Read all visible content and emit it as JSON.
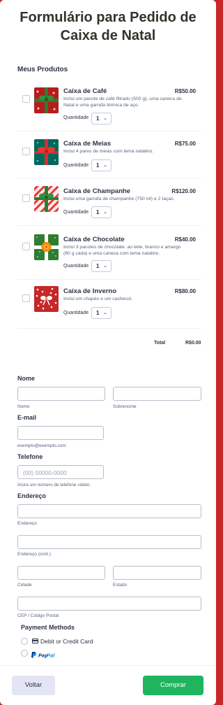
{
  "form": {
    "title_line1": "Formulário para Pedido de",
    "title_line2": "Caixa de Natal"
  },
  "products": {
    "section_label": "Meus Produtos",
    "quantity_label": "Quantidade",
    "items": [
      {
        "name": "Caixa de Café",
        "price": "R$50.00",
        "desc_line1": "Inclui um pacote de café filtrado (500 g), uma caneca de",
        "desc_line2": "Natal e uma garrafa térmica de aço.",
        "quantity": "1",
        "icon": "gift-box-red-green-bow-icon"
      },
      {
        "name": "Caixa de Meias",
        "price": "R$75.00",
        "desc_line1": "Inclui 4 pares de meias com tema natalino.",
        "desc_line2": "",
        "quantity": "1",
        "icon": "gift-box-green-red-bow-icon"
      },
      {
        "name": "Caixa de Champanhe",
        "price": "R$120.00",
        "desc_line1": "Inclui uma garrafa de champanhe (750 ml) e 2 taças.",
        "desc_line2": "",
        "quantity": "1",
        "icon": "gift-box-striped-icon"
      },
      {
        "name": "Caixa de Chocolate",
        "price": "R$40.00",
        "desc_line1": "Inclui 3 pacotes de chocolate: ao leite, branco e amargo",
        "desc_line2": "(60 g cada) e uma caneca com tema natalino.",
        "quantity": "1",
        "icon": "gift-box-green-orange-bow-icon"
      },
      {
        "name": "Caixa de Inverno",
        "price": "R$80.00",
        "desc_line1": "Inclui um chapéu e um cachecol.",
        "desc_line2": "",
        "quantity": "1",
        "icon": "gift-box-red-polka-icon"
      }
    ],
    "total_label": "Total",
    "total_value": "R$0.00"
  },
  "fields": {
    "name_label": "Nome",
    "first_name_sub": "Nome",
    "last_name_sub": "Sobrenome",
    "email_label": "E-mail",
    "email_sub": "exemplo@exemplo.com",
    "phone_label": "Telefone",
    "phone_placeholder": "(00) 00000-0000",
    "phone_sub": "Insira um número de telefone válido.",
    "address_label": "Endereço",
    "address_sub": "Endereço",
    "address2_sub": "Endereço (cont.)",
    "city_sub": "Cidade",
    "state_sub": "Estado",
    "zip_sub": "CEP / Código Postal"
  },
  "payment": {
    "label": "Payment Methods",
    "option_card": "Debit or Credit Card",
    "option_paypal": "PayPal",
    "card_icon": "credit-card-icon"
  },
  "buttons": {
    "back": "Voltar",
    "submit": "Comprar"
  },
  "colors": {
    "background": "#c62828",
    "submit": "#1fb55f",
    "back": "#e3e5f5",
    "paypal_dark": "#003087",
    "paypal_light": "#009cde"
  }
}
